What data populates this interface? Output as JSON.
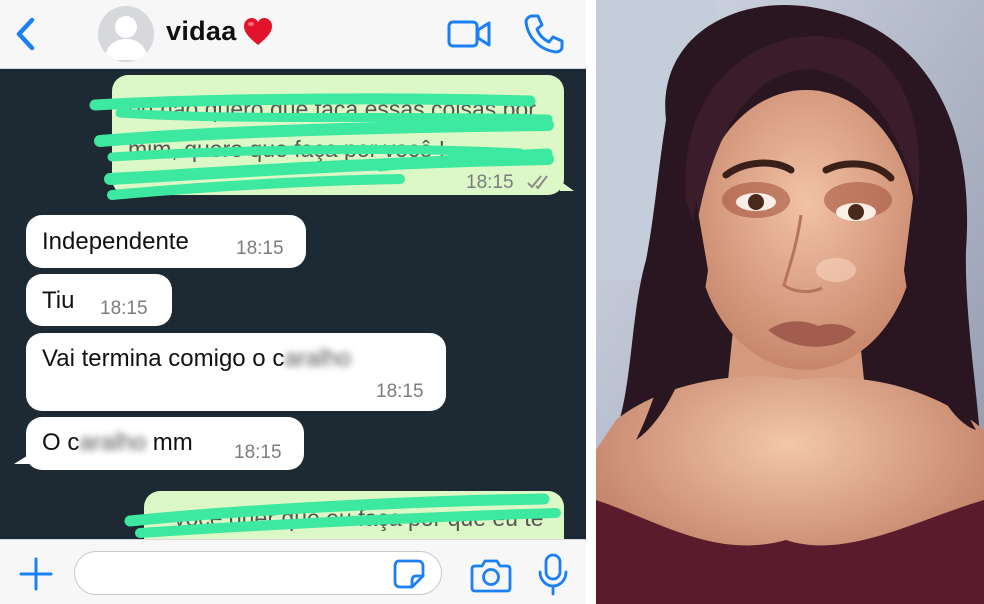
{
  "header": {
    "contact_name": "vidaa",
    "contact_emoji": "heart-emoji",
    "icons": [
      "back-chevron-icon",
      "avatar-placeholder-icon",
      "video-call-icon",
      "phone-icon"
    ]
  },
  "messages": [
    {
      "direction": "outgoing",
      "text": "eu não quero que faça essas coisas por mim, quero que faça por você !",
      "redacted": true,
      "time": "18:15",
      "status": "read-double-check"
    },
    {
      "direction": "incoming",
      "text": "Independente",
      "time": "18:15"
    },
    {
      "direction": "incoming",
      "text": "Tiu",
      "time": "18:15"
    },
    {
      "direction": "incoming",
      "text_before": "Vai termina comigo o c",
      "text_blurred": "aralho",
      "time": "18:15"
    },
    {
      "direction": "incoming",
      "text_before": "O c",
      "text_blurred": "aralho",
      "text_after": " mm",
      "time": "18:15"
    },
    {
      "direction": "outgoing",
      "text": "você quer que eu faça por que eu te",
      "redacted": true,
      "cut_off": true
    }
  ],
  "composer": {
    "placeholder": "",
    "icons": [
      "plus-icon",
      "sticker-icon",
      "camera-icon",
      "microphone-icon"
    ]
  },
  "colors": {
    "accent": "#1b7ff5",
    "chat_background": "#1d2a33",
    "outgoing_bubble": "#dcf8c6",
    "incoming_bubble": "#ffffff",
    "redaction_marker": "#3de8a0"
  },
  "photo": {
    "description_icon": "portrait-photo"
  }
}
